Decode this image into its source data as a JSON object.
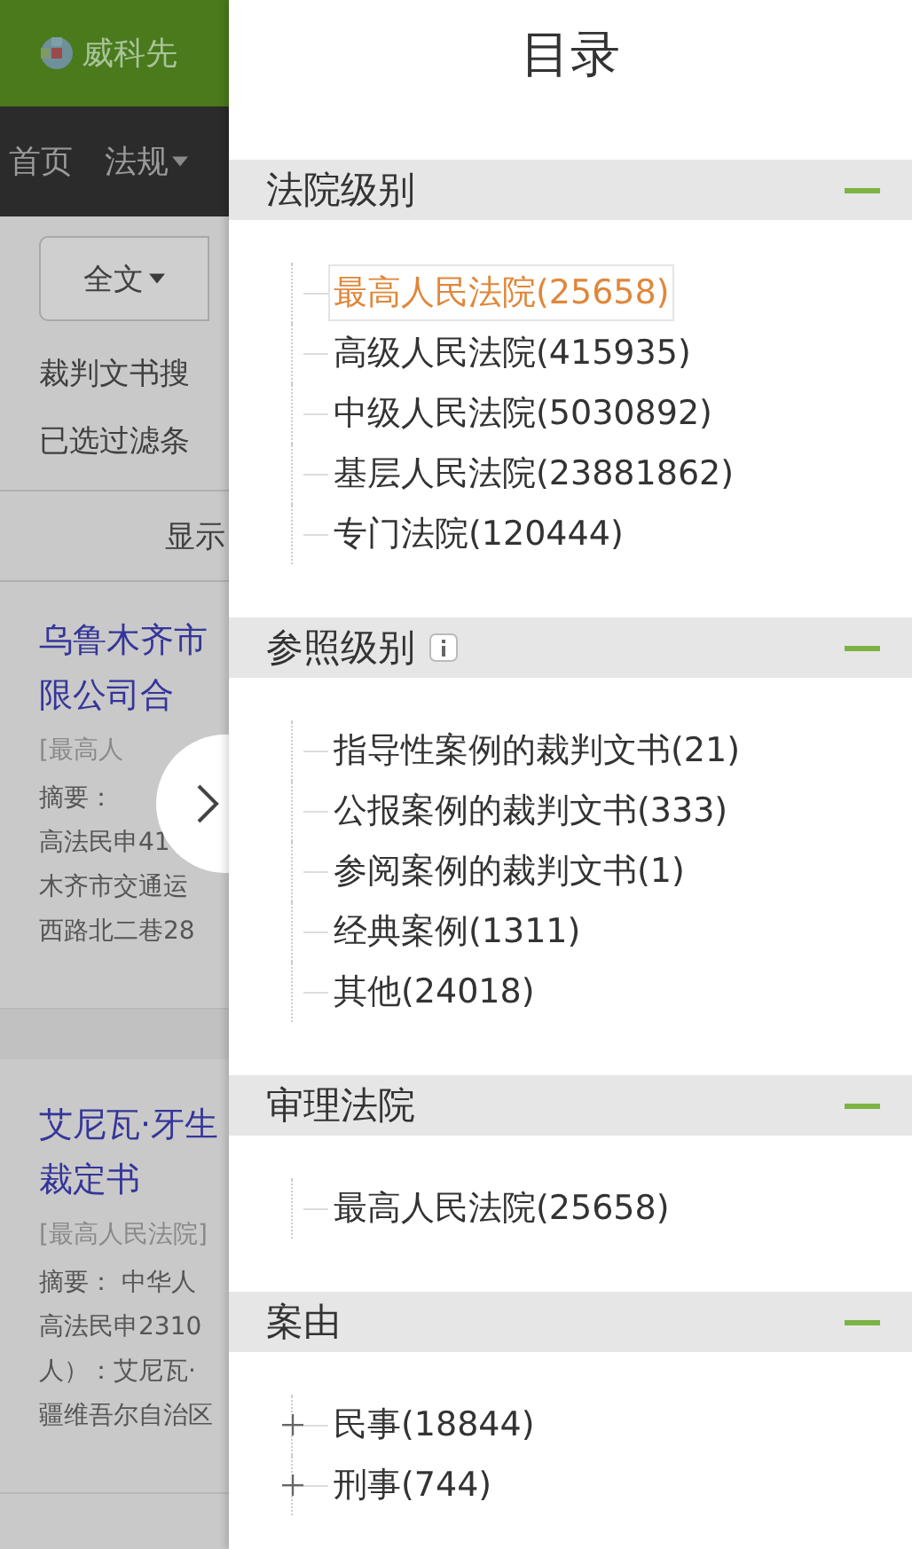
{
  "page": {
    "brand": "威科先",
    "nav": [
      {
        "label": "首页",
        "dropdown": false
      },
      {
        "label": "法规",
        "dropdown": true
      }
    ],
    "scope": {
      "label": "全文"
    },
    "lines": [
      "裁判文书搜",
      "已选过滤条"
    ],
    "show": "显示",
    "results": [
      {
        "title": [
          "乌鲁木齐市",
          "限公司合"
        ],
        "court": "[最高人",
        "abstract": [
          "摘要：",
          "高法民申41",
          "木齐市交通运",
          "西路北二巷28"
        ]
      },
      {
        "title": [
          "艾尼瓦·牙生",
          "裁定书"
        ],
        "court": "[最高人民法院]",
        "abstract": [
          "摘要： 中华人",
          "高法民申2310",
          "人）：艾尼瓦·",
          "疆维吾尔自治区"
        ]
      }
    ]
  },
  "drawer": {
    "title": "目录",
    "sections": [
      {
        "title": "法院级别",
        "info": false,
        "expanded": true,
        "items": [
          {
            "label": "最高人民法院(25658)",
            "selected": true,
            "expandable": false
          },
          {
            "label": "高级人民法院(415935)",
            "selected": false,
            "expandable": false
          },
          {
            "label": "中级人民法院(5030892)",
            "selected": false,
            "expandable": false
          },
          {
            "label": "基层人民法院(23881862)",
            "selected": false,
            "expandable": false
          },
          {
            "label": "专门法院(120444)",
            "selected": false,
            "expandable": false
          }
        ]
      },
      {
        "title": "参照级别",
        "info": true,
        "expanded": true,
        "items": [
          {
            "label": "指导性案例的裁判文书(21)",
            "selected": false,
            "expandable": false
          },
          {
            "label": "公报案例的裁判文书(333)",
            "selected": false,
            "expandable": false
          },
          {
            "label": "参阅案例的裁判文书(1)",
            "selected": false,
            "expandable": false
          },
          {
            "label": "经典案例(1311)",
            "selected": false,
            "expandable": false
          },
          {
            "label": "其他(24018)",
            "selected": false,
            "expandable": false
          }
        ]
      },
      {
        "title": "审理法院",
        "info": false,
        "expanded": true,
        "items": [
          {
            "label": "最高人民法院(25658)",
            "selected": false,
            "expandable": false
          }
        ]
      },
      {
        "title": "案由",
        "info": false,
        "expanded": true,
        "items": [
          {
            "label": "民事(18844)",
            "selected": false,
            "expandable": true
          },
          {
            "label": "刑事(744)",
            "selected": false,
            "expandable": true
          }
        ]
      }
    ]
  }
}
